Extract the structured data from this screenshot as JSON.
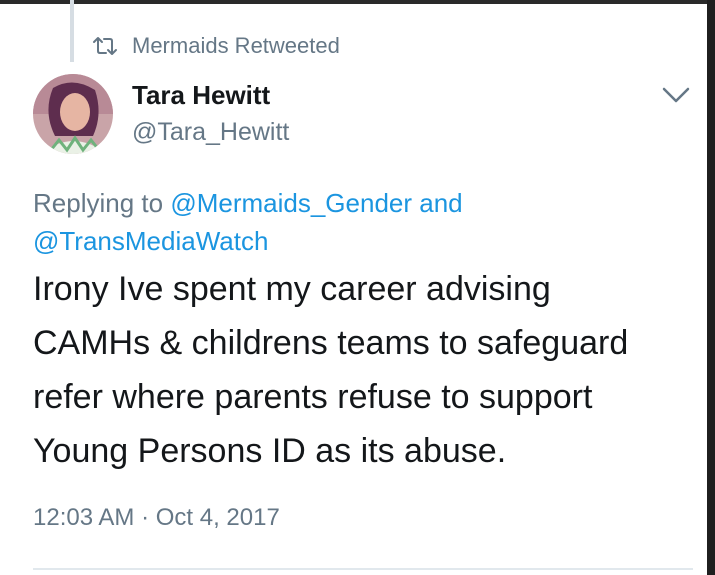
{
  "retweet": {
    "icon": "retweet-icon",
    "label": "Mermaids Retweeted"
  },
  "author": {
    "name": "Tara Hewitt",
    "handle": "@Tara_Hewitt"
  },
  "reply": {
    "prefix": "Replying to",
    "mention_1": "@Mermaids_Gender",
    "joiner": "and",
    "mention_2": "@TransMediaWatch"
  },
  "tweet": {
    "lines": [
      "Irony Ive spent my career advising",
      "CAMHs & childrens teams to safeguard",
      "refer where parents refuse to support",
      "Young Persons ID as its abuse."
    ],
    "timestamp": "12:03 AM · Oct 4, 2017"
  },
  "colors": {
    "link": "#1b95e0",
    "secondary_text": "#657786",
    "primary_text": "#14171a"
  },
  "icons": {
    "menu": "chevron-down-icon",
    "retweet": "retweet-icon"
  }
}
